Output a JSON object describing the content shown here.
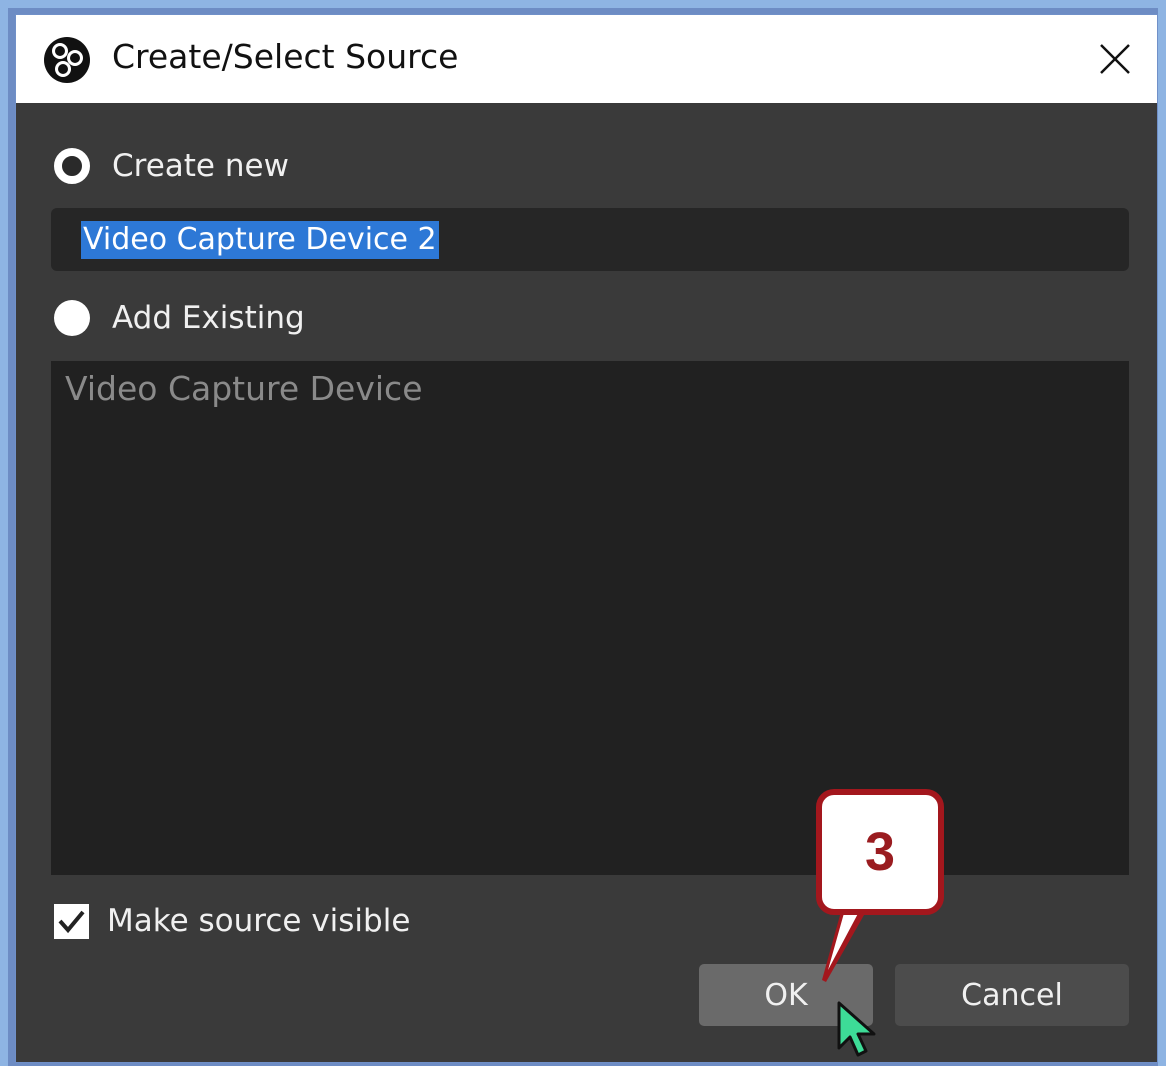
{
  "dialog": {
    "title": "Create/Select Source",
    "app_icon": "obs-logo-icon",
    "close_icon": "close-icon"
  },
  "create_new": {
    "label": "Create new",
    "selected": true,
    "name_value": "Video Capture Device 2"
  },
  "add_existing": {
    "label": "Add Existing",
    "selected": false,
    "items": [
      "Video Capture Device"
    ]
  },
  "visible_checkbox": {
    "label": "Make source visible",
    "checked": true
  },
  "buttons": {
    "ok": "OK",
    "cancel": "Cancel"
  },
  "annotation": {
    "step": "3",
    "color": "#a3171d"
  },
  "colors": {
    "dialog_bg": "#3a3a3a",
    "selection": "#2d78d6",
    "list_bg": "#212121"
  }
}
